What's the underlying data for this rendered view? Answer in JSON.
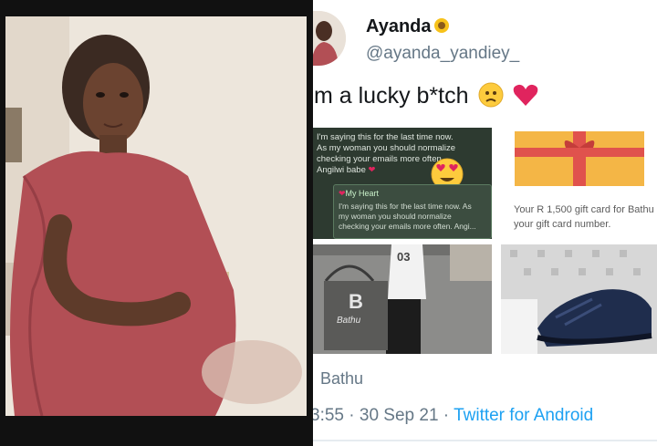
{
  "profile": {
    "display_name": "Ayanda",
    "name_emoji": "sunflower-emoji",
    "handle": "@ayanda_yandiey_"
  },
  "tweet": {
    "text": "m a lucky b*tch",
    "emojis": [
      "worried-face-emoji",
      "red-heart-emoji"
    ]
  },
  "media": {
    "chat_lines": [
      "I'm saying this for the last time now.",
      "As my woman you should normalize",
      "checking your emails more often.",
      "Angilwi babe"
    ],
    "chat_bubble": {
      "title": "My Heart",
      "lines": [
        "I'm saying this for the last time now. As",
        "my woman you should normalize",
        "checking your emails more often. Angi..."
      ]
    },
    "gift_card_lines": [
      "Your R 1,500 gift card for Bathu is",
      "your gift card number."
    ],
    "bag_brand": "Bathu",
    "shirt_number": "03"
  },
  "footer": {
    "link_label": "Bathu",
    "time": "3:55",
    "date": "30 Sep 21",
    "source": "Twitter for Android"
  },
  "colors": {
    "link_blue": "#1da1f2",
    "muted_grey": "#657786",
    "dress": "#b24f55",
    "heart": "#e0245e"
  }
}
